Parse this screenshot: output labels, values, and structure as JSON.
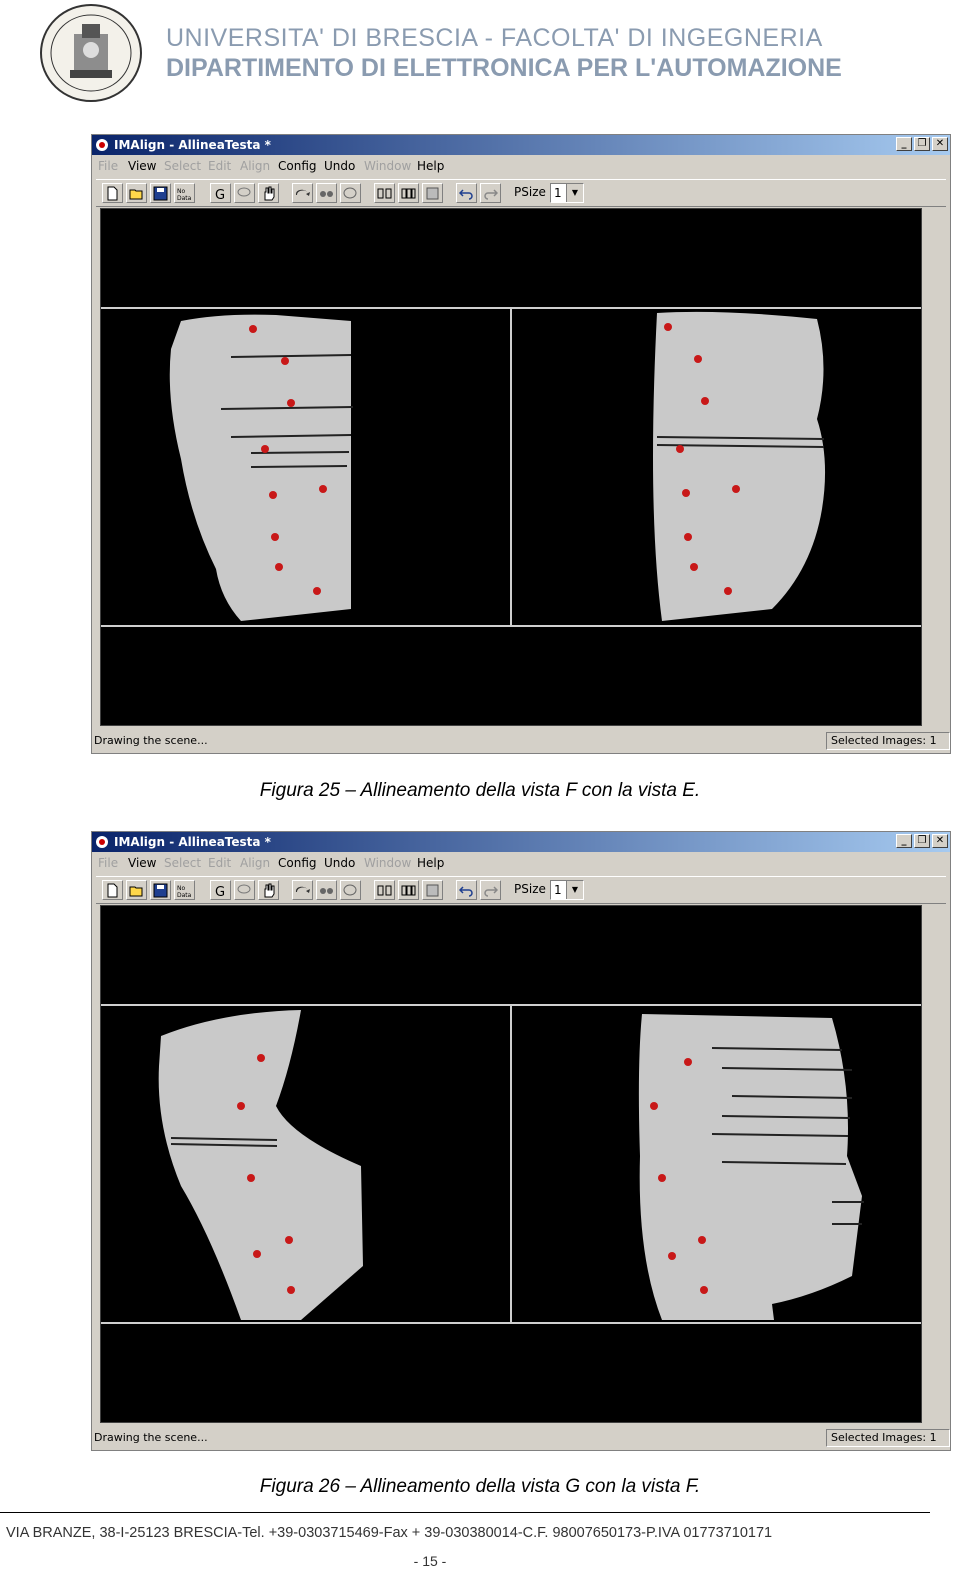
{
  "header": {
    "university": "UNIVERSITA' DI BRESCIA - FACOLTA' DI INGEGNERIA",
    "department": "DIPARTIMENTO DI ELETTRONICA PER L'AUTOMAZIONE"
  },
  "app": {
    "title": "IMAlign - AllineaTesta *",
    "menu": [
      "File",
      "View",
      "Select",
      "Edit",
      "Align",
      "Config",
      "Undo",
      "Window",
      "Help"
    ],
    "psize_label": "PSize",
    "psize_value": "1",
    "status_left": "Drawing the scene...",
    "status_right": "Selected Images: 1",
    "icons": [
      "new-icon",
      "open-icon",
      "save-icon",
      "no-data-icon",
      "g-icon",
      "lasso-icon",
      "hand-icon",
      "rotate-icon",
      "glasses-icon",
      "head-icon",
      "split-icon",
      "split2-icon",
      "grid-icon",
      "undo-icon",
      "redo-icon"
    ]
  },
  "figures": [
    {
      "caption": "Figura 25 – Allineamento della vista F con la vista E."
    },
    {
      "caption": "Figura 26 – Allineamento della vista G con la vista F."
    }
  ],
  "footer": {
    "address": "VIA BRANZE, 38-I-25123 BRESCIA-Tel. +39-0303715469-Fax + 39-030380014-C.F. 98007650173-P.IVA 01773710171",
    "page": "- 15 -"
  }
}
